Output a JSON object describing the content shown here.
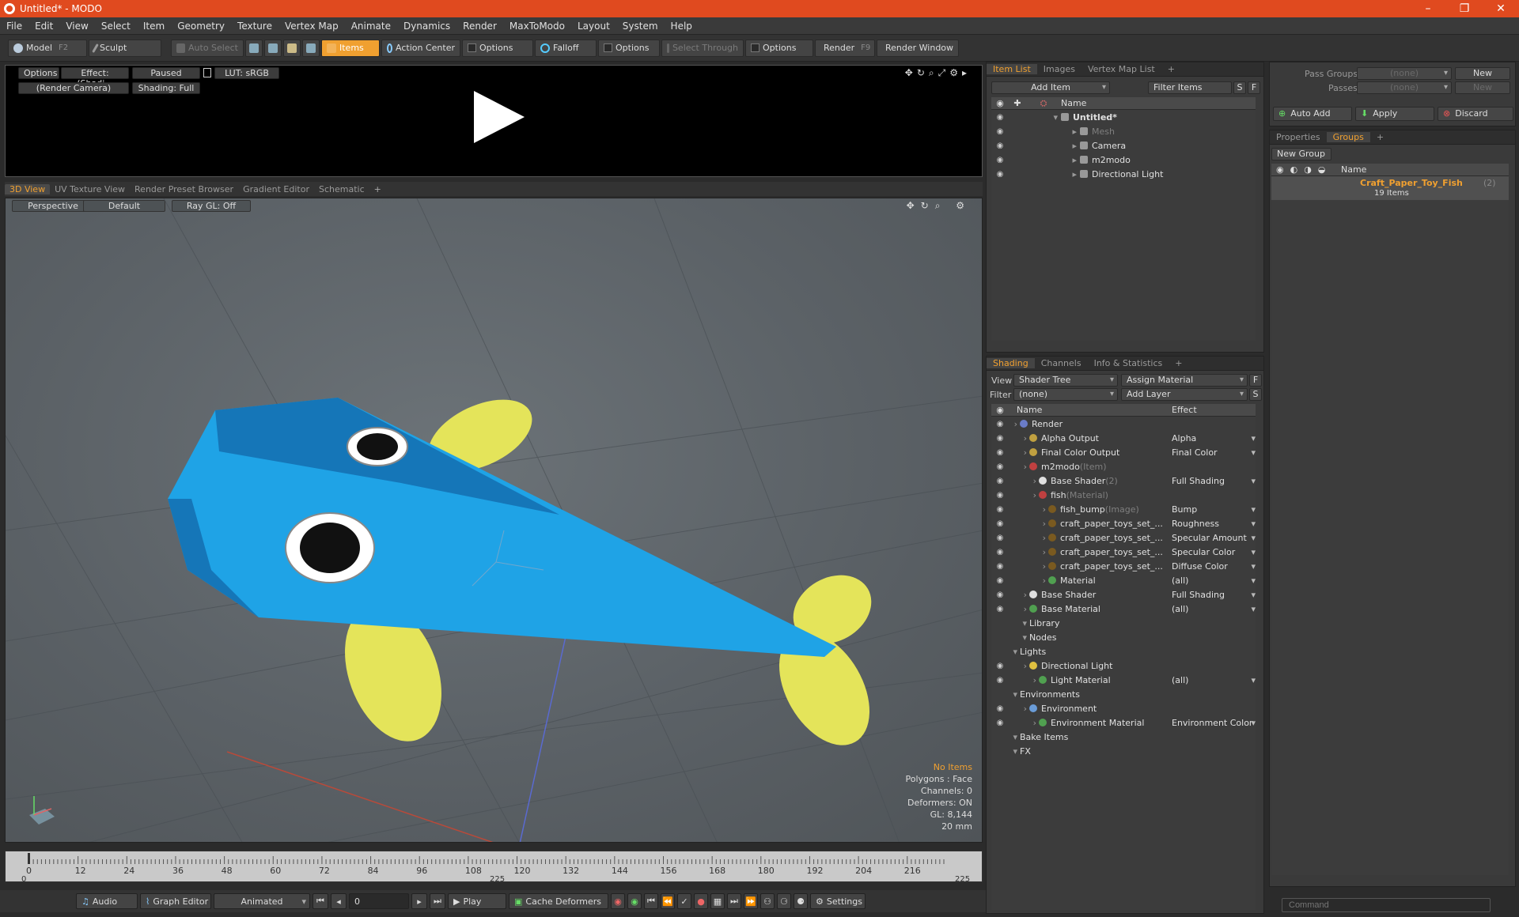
{
  "window": {
    "title": "Untitled* - MODO",
    "minimize": "–",
    "maximize": "❐",
    "close": "✕"
  },
  "menu": [
    "File",
    "Edit",
    "View",
    "Select",
    "Item",
    "Geometry",
    "Texture",
    "Vertex Map",
    "Animate",
    "Dynamics",
    "Render",
    "MaxToModo",
    "Layout",
    "System",
    "Help"
  ],
  "toolbar": {
    "model": "Model",
    "model_key": "F2",
    "sculpt": "Sculpt",
    "auto_select": "Auto Select",
    "items": "Items",
    "action_center": "Action Center",
    "options1": "Options",
    "falloff": "Falloff",
    "options2": "Options",
    "select_through": "Select Through",
    "options3": "Options",
    "render": "Render",
    "render_key": "F9",
    "render_window": "Render Window"
  },
  "preview": {
    "options": "Options",
    "effect": "Effect: (Shadi...",
    "paused": "Paused",
    "lut": "LUT: sRGB",
    "camera": "(Render Camera)",
    "shading": "Shading: Full"
  },
  "view_tabs": [
    "3D View",
    "UV Texture View",
    "Render Preset Browser",
    "Gradient Editor",
    "Schematic",
    "+"
  ],
  "viewport": {
    "perspective": "Perspective",
    "default": "Default",
    "raygl": "Ray GL: Off",
    "stats": {
      "no_items": "No Items",
      "polygons": "Polygons : Face",
      "channels": "Channels: 0",
      "deformers": "Deformers: ON",
      "gl": "GL: 8,144",
      "scale": "20 mm"
    }
  },
  "timeline": {
    "ticks": [
      "0",
      "12",
      "24",
      "36",
      "48",
      "60",
      "72",
      "84",
      "96",
      "108",
      "120",
      "132",
      "144",
      "156",
      "168",
      "180",
      "192",
      "204",
      "216"
    ],
    "start": "0",
    "mid": "225",
    "end": "225"
  },
  "bottombar": {
    "audio": "Audio",
    "graph_editor": "Graph Editor",
    "animated": "Animated",
    "frame": "0",
    "play": "Play",
    "cache": "Cache Deformers",
    "settings": "Settings"
  },
  "itemlist": {
    "tabs": [
      "Item List",
      "Images",
      "Vertex Map List",
      "+"
    ],
    "add_item": "Add Item",
    "filter": "Filter Items",
    "s": "S",
    "f": "F",
    "col_name": "Name",
    "items": [
      {
        "label": "Untitled*",
        "indent": 0,
        "bold": true
      },
      {
        "label": "Mesh",
        "indent": 1,
        "dim": true
      },
      {
        "label": "Camera",
        "indent": 1
      },
      {
        "label": "m2modo",
        "indent": 1
      },
      {
        "label": "Directional Light",
        "indent": 1
      }
    ]
  },
  "shading": {
    "tabs": [
      "Shading",
      "Channels",
      "Info & Statistics",
      "+"
    ],
    "view_label": "View",
    "view_value": "Shader Tree",
    "assign_material": "Assign Material",
    "f": "F",
    "filter_label": "Filter",
    "filter_value": "(none)",
    "add_layer": "Add Layer",
    "s": "S",
    "col_name": "Name",
    "col_effect": "Effect",
    "rows": [
      {
        "label": "Render",
        "suffix": "",
        "effect": "",
        "indent": 0,
        "color": "#6a7cc8"
      },
      {
        "label": "Alpha Output",
        "suffix": "",
        "effect": "Alpha",
        "indent": 1,
        "color": "#c0a040"
      },
      {
        "label": "Final Color Output",
        "suffix": "",
        "effect": "Final Color",
        "indent": 1,
        "color": "#c0a040"
      },
      {
        "label": "m2modo",
        "suffix": " (Item)",
        "effect": "",
        "indent": 1,
        "color": "#c04040"
      },
      {
        "label": "Base Shader",
        "suffix": " (2)",
        "effect": "Full Shading",
        "indent": 2,
        "color": "#e0e0e0"
      },
      {
        "label": "fish",
        "suffix": " (Material)",
        "effect": "",
        "indent": 2,
        "color": "#c04040"
      },
      {
        "label": "fish_bump",
        "suffix": " (Image)",
        "effect": "Bump",
        "indent": 3,
        "color": "#7a5a20"
      },
      {
        "label": "craft_paper_toys_set_...",
        "suffix": "",
        "effect": "Roughness",
        "indent": 3,
        "color": "#7a5a20"
      },
      {
        "label": "craft_paper_toys_set_...",
        "suffix": "",
        "effect": "Specular Amount",
        "indent": 3,
        "color": "#7a5a20"
      },
      {
        "label": "craft_paper_toys_set_...",
        "suffix": "",
        "effect": "Specular Color",
        "indent": 3,
        "color": "#7a5a20"
      },
      {
        "label": "craft_paper_toys_set_...",
        "suffix": "",
        "effect": "Diffuse Color",
        "indent": 3,
        "color": "#7a5a20"
      },
      {
        "label": "Material",
        "suffix": "",
        "effect": "(all)",
        "indent": 3,
        "color": "#50a050"
      },
      {
        "label": "Base Shader",
        "suffix": "",
        "effect": "Full Shading",
        "indent": 1,
        "color": "#e0e0e0"
      },
      {
        "label": "Base Material",
        "suffix": "",
        "effect": "(all)",
        "indent": 1,
        "color": "#50a050"
      },
      {
        "label": "Library",
        "suffix": "",
        "effect": "",
        "indent": 1,
        "color": ""
      },
      {
        "label": "Nodes",
        "suffix": "",
        "effect": "",
        "indent": 1,
        "color": ""
      },
      {
        "label": "Lights",
        "suffix": "",
        "effect": "",
        "indent": 0,
        "color": ""
      },
      {
        "label": "Directional Light",
        "suffix": "",
        "effect": "",
        "indent": 1,
        "color": "#e0c040"
      },
      {
        "label": "Light Material",
        "suffix": "",
        "effect": "(all)",
        "indent": 2,
        "color": "#50a050"
      },
      {
        "label": "Environments",
        "suffix": "",
        "effect": "",
        "indent": 0,
        "color": ""
      },
      {
        "label": "Environment",
        "suffix": "",
        "effect": "",
        "indent": 1,
        "color": "#6a9cd8"
      },
      {
        "label": "Environment Material",
        "suffix": "",
        "effect": "Environment Color",
        "indent": 2,
        "color": "#50a050"
      },
      {
        "label": "Bake Items",
        "suffix": "",
        "effect": "",
        "indent": 0,
        "color": ""
      },
      {
        "label": "FX",
        "suffix": "",
        "effect": "",
        "indent": 0,
        "color": ""
      }
    ]
  },
  "passes": {
    "pass_groups": "Pass Groups",
    "passes": "Passes",
    "none1": "(none)",
    "none2": "(none)",
    "new1": "New",
    "new2": "New",
    "auto_add": "Auto Add",
    "apply": "Apply",
    "discard": "Discard"
  },
  "groups": {
    "tabs": [
      "Properties",
      "Groups",
      "+"
    ],
    "new_group": "New Group",
    "col_name": "Name",
    "group_name": "Craft_Paper_Toy_Fish",
    "group_count": " (2)",
    "group_items": "19 Items"
  },
  "command": {
    "placeholder": "Command"
  }
}
